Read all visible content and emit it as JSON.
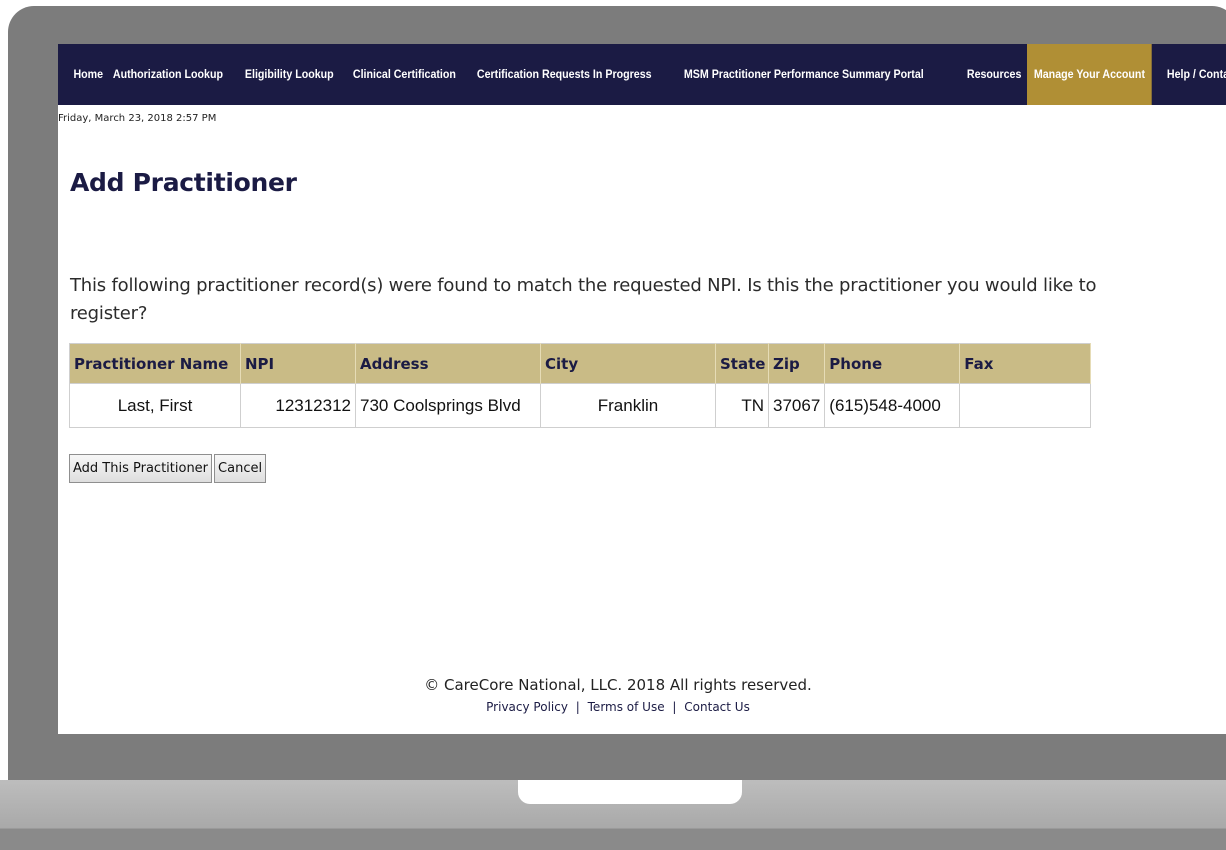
{
  "nav": {
    "items": [
      {
        "label": "Home"
      },
      {
        "label": "Authorization Lookup"
      },
      {
        "label": "Eligibility Lookup"
      },
      {
        "label": "Clinical Certification"
      },
      {
        "label": "Certification Requests In Progress"
      },
      {
        "label": "MSM Practitioner Performance Summary Portal"
      },
      {
        "label": "Resources"
      },
      {
        "label": "Manage Your Account",
        "active": true
      },
      {
        "label": "Help / Contact Us"
      }
    ]
  },
  "datetime": "Friday, March 23, 2018 2:57 PM",
  "page_title": "Add Practitioner",
  "prompt": "This following practitioner record(s) were found to match the requested NPI. Is this the practitioner you would like to register?",
  "table": {
    "headers": [
      "Practitioner Name",
      "NPI",
      "Address",
      "City",
      "State",
      "Zip",
      "Phone",
      "Fax"
    ],
    "rows": [
      [
        "Last, First",
        "12312312",
        "730 Coolsprings Blvd",
        "Franklin",
        "TN",
        "37067",
        "(615)548-4000",
        ""
      ]
    ]
  },
  "buttons": {
    "add": "Add This Practitioner",
    "cancel": "Cancel"
  },
  "footer": {
    "copyright": "© CareCore National, LLC. 2018 All rights reserved.",
    "privacy": "Privacy Policy",
    "terms": "Terms of Use",
    "contact": "Contact Us",
    "separator": "|"
  },
  "colors": {
    "nav_bg": "#1b1b44",
    "nav_active": "#b08f35",
    "table_header": "#c9bb86",
    "bezel": "#7c7c7c"
  }
}
